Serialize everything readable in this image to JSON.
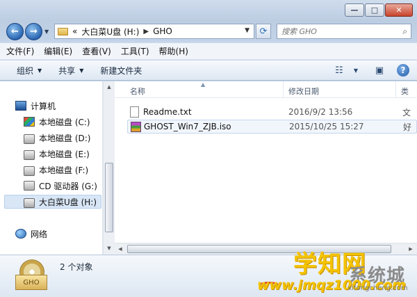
{
  "window": {
    "min_glyph": "—",
    "max_glyph": "□",
    "close_glyph": "✕"
  },
  "address": {
    "nav_prefix": "«",
    "crumbs": [
      "大白菜U盘 (H:)",
      "GHO"
    ],
    "search_placeholder": "搜索 GHO"
  },
  "menu": [
    "文件(F)",
    "编辑(E)",
    "查看(V)",
    "工具(T)",
    "帮助(H)"
  ],
  "toolbar": {
    "organize": "组织",
    "share": "共享",
    "new_folder": "新建文件夹",
    "help": "?"
  },
  "nav": {
    "computer": "计算机",
    "drives": [
      {
        "label": "本地磁盘 (C:)",
        "icon": "system-drive-icon"
      },
      {
        "label": "本地磁盘 (D:)",
        "icon": "drive-icon"
      },
      {
        "label": "本地磁盘 (E:)",
        "icon": "drive-icon"
      },
      {
        "label": "本地磁盘 (F:)",
        "icon": "drive-icon"
      },
      {
        "label": "CD 驱动器 (G:)",
        "icon": "cd-drive-icon"
      },
      {
        "label": "大白菜U盘 (H:)",
        "icon": "usb-drive-icon",
        "selected": true
      }
    ],
    "network": "网络"
  },
  "columns": {
    "name": "名称",
    "date": "修改日期",
    "type": "类"
  },
  "files": [
    {
      "name": "Readme.txt",
      "date": "2016/9/2 13:56",
      "type": "文",
      "icon": "text-file-icon"
    },
    {
      "name": "GHOST_Win7_ZJB.iso",
      "date": "2015/10/25 15:27",
      "type": "好",
      "icon": "archive-file-icon"
    }
  ],
  "details": {
    "icon_label": "GHO",
    "count": "2 个对象"
  },
  "watermark": {
    "line1": "学知网",
    "line2": "系统城",
    "line3": "www.jmqz1000.com",
    "line4": "xitongcheng.com"
  },
  "colors": {
    "accent": "#2b67b3",
    "watermark_yellow": "#f4c300"
  }
}
